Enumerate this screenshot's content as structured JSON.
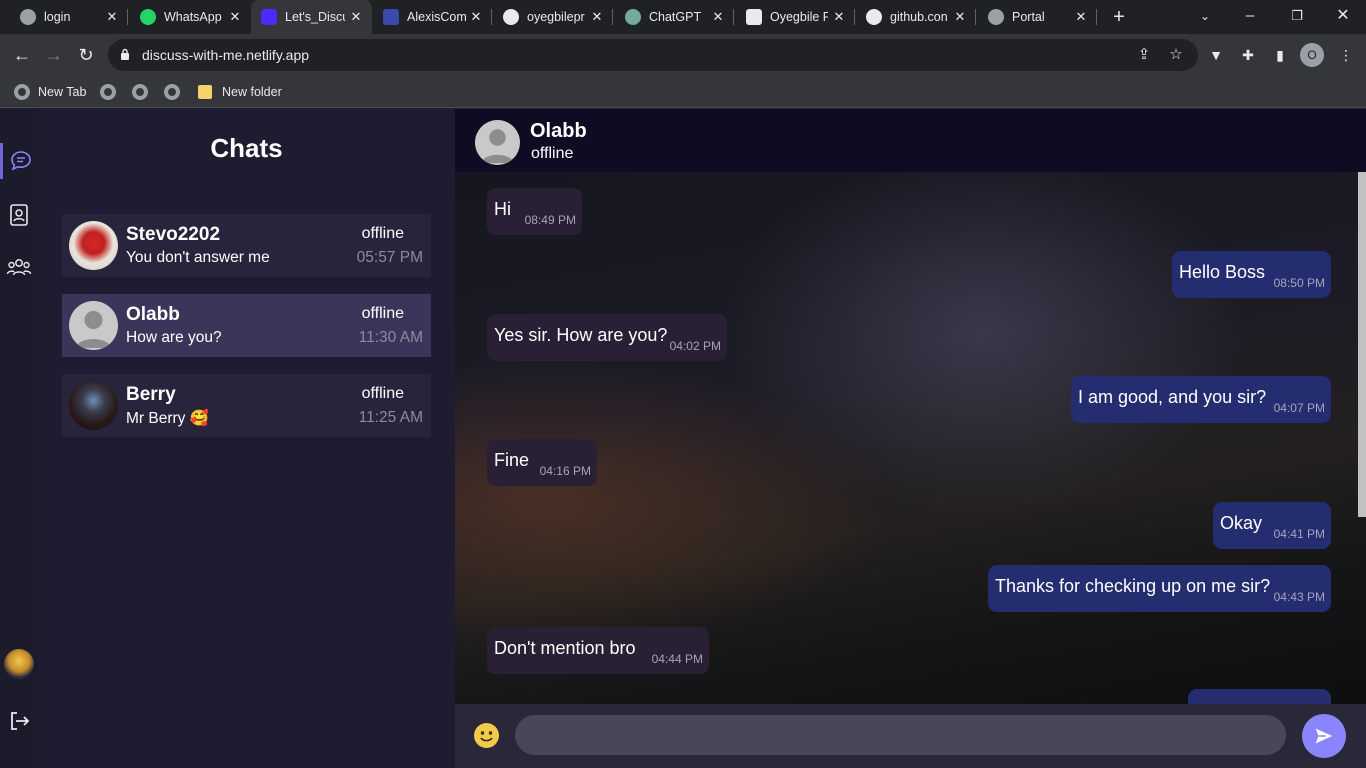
{
  "browser": {
    "tabs": [
      {
        "label": "login",
        "fav_color": "#9aa0a6"
      },
      {
        "label": "WhatsApp",
        "fav_color": "#25d366"
      },
      {
        "label": "Let's_Discu",
        "fav_color": "#4b2bff"
      },
      {
        "label": "AlexisCom",
        "fav_color": "#3b4aa8"
      },
      {
        "label": "oyegbilepr",
        "fav_color": "#e8eaed"
      },
      {
        "label": "ChatGPT",
        "fav_color": "#74aa9c"
      },
      {
        "label": "Oyegbile F",
        "fav_color": "#e8eaed"
      },
      {
        "label": "github.con",
        "fav_color": "#e8eaed"
      },
      {
        "label": "Portal",
        "fav_color": "#9aa0a6"
      }
    ],
    "url": "discuss-with-me.netlify.app",
    "profile_initial": "O",
    "bookmarks": [
      {
        "label": "New Tab"
      },
      {
        "label": ""
      },
      {
        "label": ""
      },
      {
        "label": ""
      },
      {
        "label": "New folder"
      }
    ]
  },
  "sidebar": {
    "title": "Chats",
    "chats": [
      {
        "name": "Stevo2202",
        "preview": "You don't answer me",
        "status": "offline",
        "time": "05:57 PM"
      },
      {
        "name": "Olabb",
        "preview": "How are you?",
        "status": "offline",
        "time": "11:30 AM"
      },
      {
        "name": "Berry",
        "preview": "Mr Berry 🥰",
        "status": "offline",
        "time": "11:25 AM"
      }
    ]
  },
  "conversation": {
    "name": "Olabb",
    "status": "offline",
    "messages": [
      {
        "direction": "in",
        "text": "Hi",
        "time": "08:49 PM"
      },
      {
        "direction": "out",
        "text": "Hello Boss",
        "time": "08:50 PM"
      },
      {
        "direction": "in",
        "text": "Yes sir. How are you?",
        "time": "04:02 PM"
      },
      {
        "direction": "out",
        "text": "I am good, and you sir?",
        "time": "04:07 PM"
      },
      {
        "direction": "in",
        "text": "Fine",
        "time": "04:16 PM"
      },
      {
        "direction": "out",
        "text": "Okay",
        "time": "04:41 PM"
      },
      {
        "direction": "out",
        "text": "Thanks for checking up on me sir?",
        "time": "04:43 PM"
      },
      {
        "direction": "in",
        "text": "Don't mention bro",
        "time": "04:44 PM"
      }
    ],
    "composer": {
      "placeholder": ""
    }
  },
  "colors": {
    "accent": "#8b84ff",
    "outgoing_bubble": "#242d70",
    "incoming_bubble": "#2a2035",
    "sidebar_bg": "#1f1c31",
    "selected_chat": "#3a365a"
  }
}
